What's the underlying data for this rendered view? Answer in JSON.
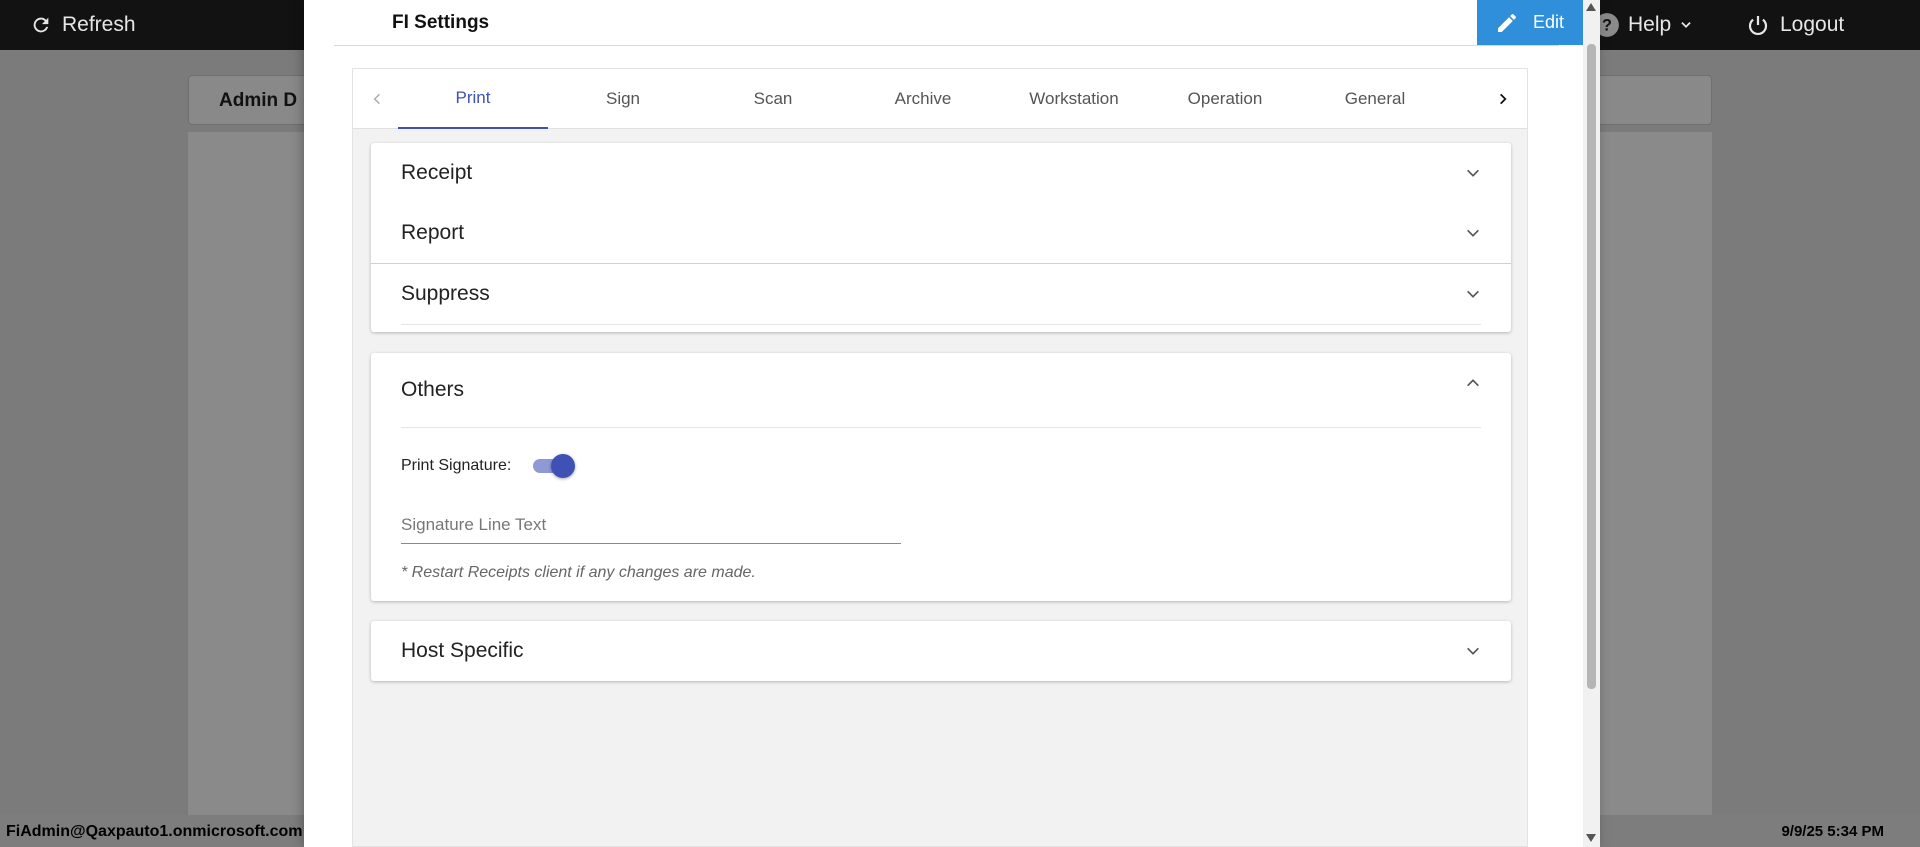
{
  "topbar": {
    "refresh_label": "Refresh",
    "help_label": "Help",
    "logout_label": "Logout"
  },
  "background": {
    "page_title": "Admin D"
  },
  "footer": {
    "user": "FiAdmin@Qaxpauto1.onmicrosoft.com",
    "timestamp": "9/9/25 5:34 PM"
  },
  "modal": {
    "title": "FI Settings",
    "edit_label": "Edit"
  },
  "tabs": [
    {
      "label": "Print",
      "active": true
    },
    {
      "label": "Sign",
      "active": false
    },
    {
      "label": "Scan",
      "active": false
    },
    {
      "label": "Archive",
      "active": false
    },
    {
      "label": "Workstation",
      "active": false
    },
    {
      "label": "Operation",
      "active": false
    },
    {
      "label": "General",
      "active": false
    }
  ],
  "sections": {
    "receipt": "Receipt",
    "report": "Report",
    "suppress": "Suppress",
    "others": "Others",
    "host_specific": "Host Specific"
  },
  "others": {
    "print_signature_label": "Print Signature:",
    "print_signature_on": true,
    "signature_line_text_value": "",
    "signature_line_text_placeholder": "Signature Line Text",
    "restart_note": "* Restart Receipts client if any changes are made."
  },
  "colors": {
    "accent": "#3f51b5",
    "edit_button": "#2f8fdb",
    "topbar": "#121212"
  },
  "icons": {
    "refresh": "refresh-icon",
    "help": "help-circle-icon",
    "logout": "power-icon",
    "edit": "pencil-icon"
  }
}
